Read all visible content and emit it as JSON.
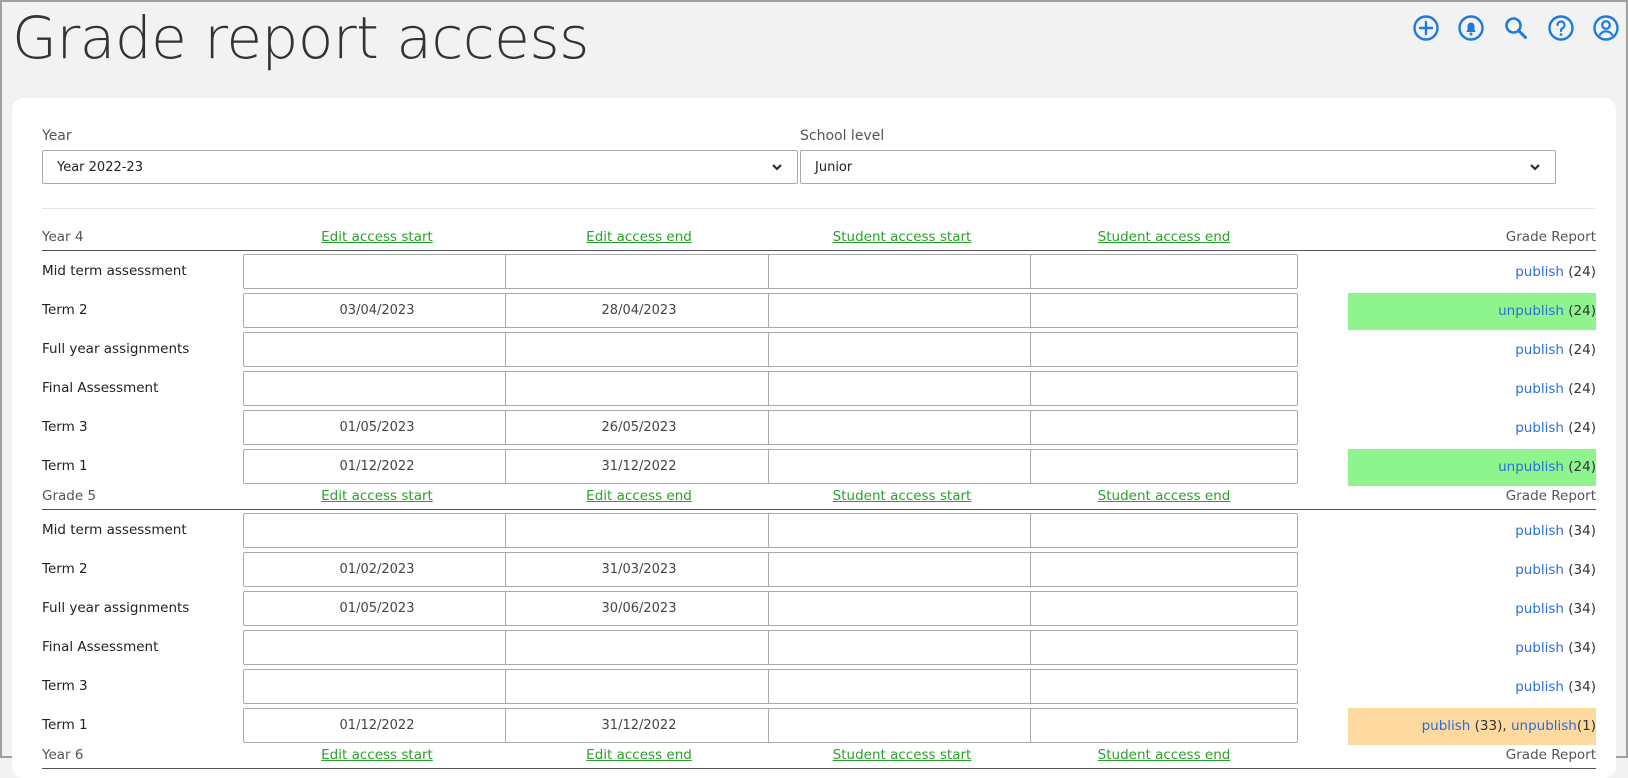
{
  "page": {
    "title": "Grade report access"
  },
  "filters": {
    "year_label": "Year",
    "year_value": "Year 2022-23",
    "level_label": "School level",
    "level_value": "Junior"
  },
  "columns": {
    "edit_start": "Edit access start",
    "edit_end": "Edit access end",
    "student_start": "Student access start",
    "student_end": "Student access end",
    "grade_report": "Grade Report"
  },
  "groups": [
    {
      "name": "Year 4",
      "rows": [
        {
          "label": "Mid term assessment",
          "edit_start": "",
          "edit_end": "",
          "student_start": "",
          "student_end": "",
          "action": "publish",
          "count": "(24)"
        },
        {
          "label": "Term 2",
          "edit_start": "03/04/2023",
          "edit_end": "28/04/2023",
          "student_start": "",
          "student_end": "",
          "action": "unpublish",
          "count": "(24)"
        },
        {
          "label": "Full year assignments",
          "edit_start": "",
          "edit_end": "",
          "student_start": "",
          "student_end": "",
          "action": "publish",
          "count": "(24)"
        },
        {
          "label": "Final Assessment",
          "edit_start": "",
          "edit_end": "",
          "student_start": "",
          "student_end": "",
          "action": "publish",
          "count": "(24)"
        },
        {
          "label": "Term 3",
          "edit_start": "01/05/2023",
          "edit_end": "26/05/2023",
          "student_start": "",
          "student_end": "",
          "action": "publish",
          "count": "(24)"
        },
        {
          "label": "Term 1",
          "edit_start": "01/12/2022",
          "edit_end": "31/12/2022",
          "student_start": "",
          "student_end": "",
          "action": "unpublish",
          "count": "(24)"
        }
      ]
    },
    {
      "name": "Grade 5",
      "rows": [
        {
          "label": "Mid term assessment",
          "edit_start": "",
          "edit_end": "",
          "student_start": "",
          "student_end": "",
          "action": "publish",
          "count": "(34)"
        },
        {
          "label": "Term 2",
          "edit_start": "01/02/2023",
          "edit_end": "31/03/2023",
          "student_start": "",
          "student_end": "",
          "action": "publish",
          "count": "(34)"
        },
        {
          "label": "Full year assignments",
          "edit_start": "01/05/2023",
          "edit_end": "30/06/2023",
          "student_start": "",
          "student_end": "",
          "action": "publish",
          "count": "(34)"
        },
        {
          "label": "Final Assessment",
          "edit_start": "",
          "edit_end": "",
          "student_start": "",
          "student_end": "",
          "action": "publish",
          "count": "(34)"
        },
        {
          "label": "Term 3",
          "edit_start": "",
          "edit_end": "",
          "student_start": "",
          "student_end": "",
          "action": "publish",
          "count": "(34)"
        },
        {
          "label": "Term 1",
          "edit_start": "01/12/2022",
          "edit_end": "31/12/2022",
          "student_start": "",
          "student_end": "",
          "action": "publish",
          "count": "(33),",
          "action2": "unpublish",
          "count2": "(1)"
        }
      ]
    },
    {
      "name": "Year 6",
      "rows": []
    }
  ],
  "colors": {
    "published": "#8ef58e",
    "partial": "#fdd9a0",
    "link": "#2b6fd6",
    "header_link": "#2aa12a"
  },
  "icons": [
    "add-circle-icon",
    "bell-icon",
    "search-icon",
    "help-icon",
    "account-icon"
  ]
}
